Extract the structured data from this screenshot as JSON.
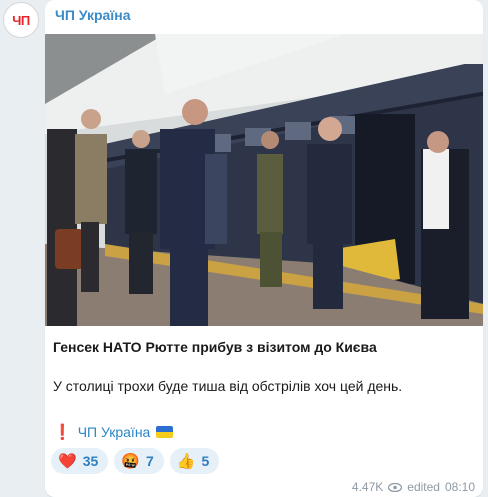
{
  "channel": {
    "avatar_text": "ЧП",
    "name": "ЧП Україна"
  },
  "post": {
    "title": "Генсек НАТО Рютте прибув з візитом до Києва",
    "body": "У столиці трохи буде тиша від обстрілів хоч цей день.",
    "signature": "ЧП Україна",
    "signature_icon": "exclamation-icon",
    "flag_icon": "ukraine-flag-icon"
  },
  "reactions": [
    {
      "emoji": "❤️",
      "icon": "heart-icon",
      "count": "35"
    },
    {
      "emoji": "🤬",
      "icon": "angry-face-icon",
      "count": "7"
    },
    {
      "emoji": "👍",
      "icon": "thumbs-up-icon",
      "count": "5"
    }
  ],
  "meta": {
    "views": "4.47K",
    "edited_label": "edited",
    "time": "08:10"
  },
  "colors": {
    "accent": "#3a8bc7",
    "background": "#e9eef2",
    "reaction_bg": "#e6f0f8"
  }
}
